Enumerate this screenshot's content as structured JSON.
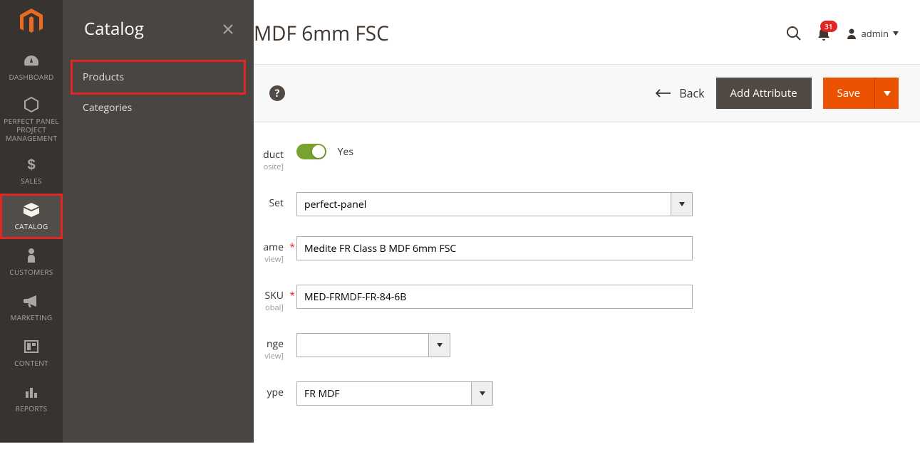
{
  "submenu": {
    "title": "Catalog",
    "items": [
      "Products",
      "Categories"
    ]
  },
  "rail": {
    "dashboard": "DASHBOARD",
    "ppp": "PERFECT PANEL PROJECT MANAGEMENT",
    "sales": "SALES",
    "catalog": "CATALOG",
    "customers": "CUSTOMERS",
    "marketing": "MARKETING",
    "content": "CONTENT",
    "reports": "REPORTS"
  },
  "header": {
    "title": "MDF 6mm FSC",
    "notif_count": "31",
    "admin_label": "admin"
  },
  "toolbar": {
    "back": "Back",
    "add_attr": "Add Attribute",
    "save": "Save"
  },
  "form": {
    "enable_label_tail": "duct",
    "enable_scope": "osite]",
    "enable_value": "Yes",
    "set_label": "Set",
    "set_value": "perfect-panel",
    "name_label": "ame",
    "name_scope": "view]",
    "name_value": "Medite FR Class B MDF 6mm FSC",
    "sku_label": "SKU",
    "sku_scope": "obal]",
    "sku_value": "MED-FRMDF-FR-84-6B",
    "range_label": "nge",
    "range_scope": "view]",
    "type_label": "ype",
    "type_value": "FR MDF"
  }
}
